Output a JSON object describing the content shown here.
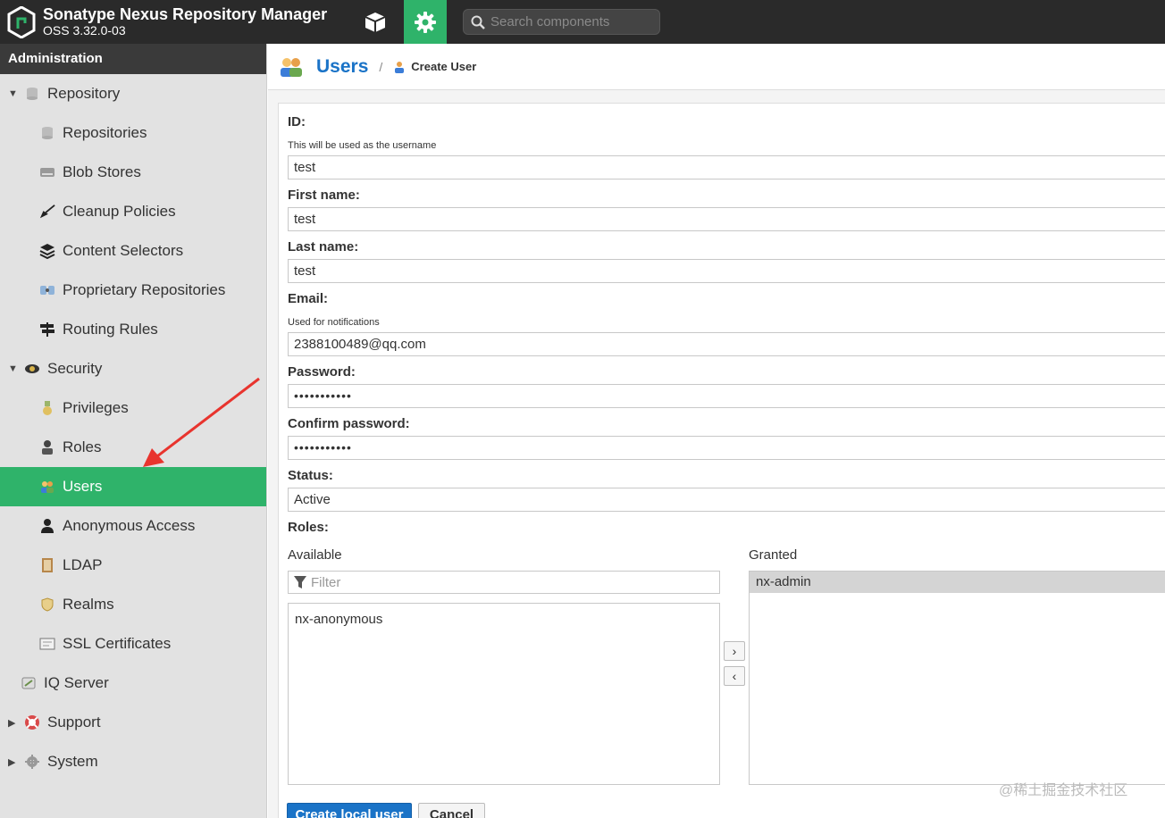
{
  "header": {
    "app_name": "Sonatype Nexus Repository Manager",
    "version": "OSS 3.32.0-03",
    "search_placeholder": "Search components"
  },
  "sidebar": {
    "title": "Administration",
    "items": [
      {
        "label": "Repository",
        "level": 0,
        "expanded": true,
        "icon": "database-icon"
      },
      {
        "label": "Repositories",
        "level": 1,
        "icon": "database-icon"
      },
      {
        "label": "Blob Stores",
        "level": 1,
        "icon": "hard-drive-icon"
      },
      {
        "label": "Cleanup Policies",
        "level": 1,
        "icon": "broom-icon"
      },
      {
        "label": "Content Selectors",
        "level": 1,
        "icon": "layers-icon"
      },
      {
        "label": "Proprietary Repositories",
        "level": 1,
        "icon": "puzzle-icon"
      },
      {
        "label": "Routing Rules",
        "level": 1,
        "icon": "signpost-icon"
      },
      {
        "label": "Security",
        "level": 0,
        "expanded": true,
        "icon": "badge-icon"
      },
      {
        "label": "Privileges",
        "level": 1,
        "icon": "medal-icon"
      },
      {
        "label": "Roles",
        "level": 1,
        "icon": "role-icon"
      },
      {
        "label": "Users",
        "level": 1,
        "active": true,
        "icon": "users-icon"
      },
      {
        "label": "Anonymous Access",
        "level": 1,
        "icon": "person-icon"
      },
      {
        "label": "LDAP",
        "level": 1,
        "icon": "book-icon"
      },
      {
        "label": "Realms",
        "level": 1,
        "icon": "shield-icon"
      },
      {
        "label": "SSL Certificates",
        "level": 1,
        "icon": "certificate-icon"
      },
      {
        "label": "IQ Server",
        "level": 0,
        "noarrow": true,
        "icon": "iq-icon"
      },
      {
        "label": "Support",
        "level": 0,
        "expanded": false,
        "icon": "lifebuoy-icon"
      },
      {
        "label": "System",
        "level": 0,
        "expanded": false,
        "icon": "gear-icon"
      }
    ]
  },
  "breadcrumb": {
    "title": "Users",
    "separator": "/",
    "current": "Create User"
  },
  "form": {
    "id": {
      "label": "ID:",
      "help": "This will be used as the username",
      "value": "test"
    },
    "first_name": {
      "label": "First name:",
      "value": "test"
    },
    "last_name": {
      "label": "Last name:",
      "value": "test"
    },
    "email": {
      "label": "Email:",
      "help": "Used for notifications",
      "value": "2388100489@qq.com"
    },
    "password": {
      "label": "Password:",
      "value": "•••••••••••"
    },
    "confirm_password": {
      "label": "Confirm password:",
      "value": "•••••••••••"
    },
    "status": {
      "label": "Status:",
      "value": "Active"
    },
    "roles": {
      "label": "Roles:",
      "available_label": "Available",
      "granted_label": "Granted",
      "filter_placeholder": "Filter",
      "available": [
        "nx-anonymous"
      ],
      "granted": [
        "nx-admin"
      ],
      "add_glyph": "›",
      "remove_glyph": "‹"
    },
    "create_button": "Create local user",
    "cancel_button": "Cancel"
  },
  "watermark": "@稀土掘金技术社区",
  "colors": {
    "header_bg": "#2a2a2a",
    "accent_green": "#2fb36a",
    "primary_blue": "#1a73c7",
    "annotation_red": "#e8342e"
  }
}
